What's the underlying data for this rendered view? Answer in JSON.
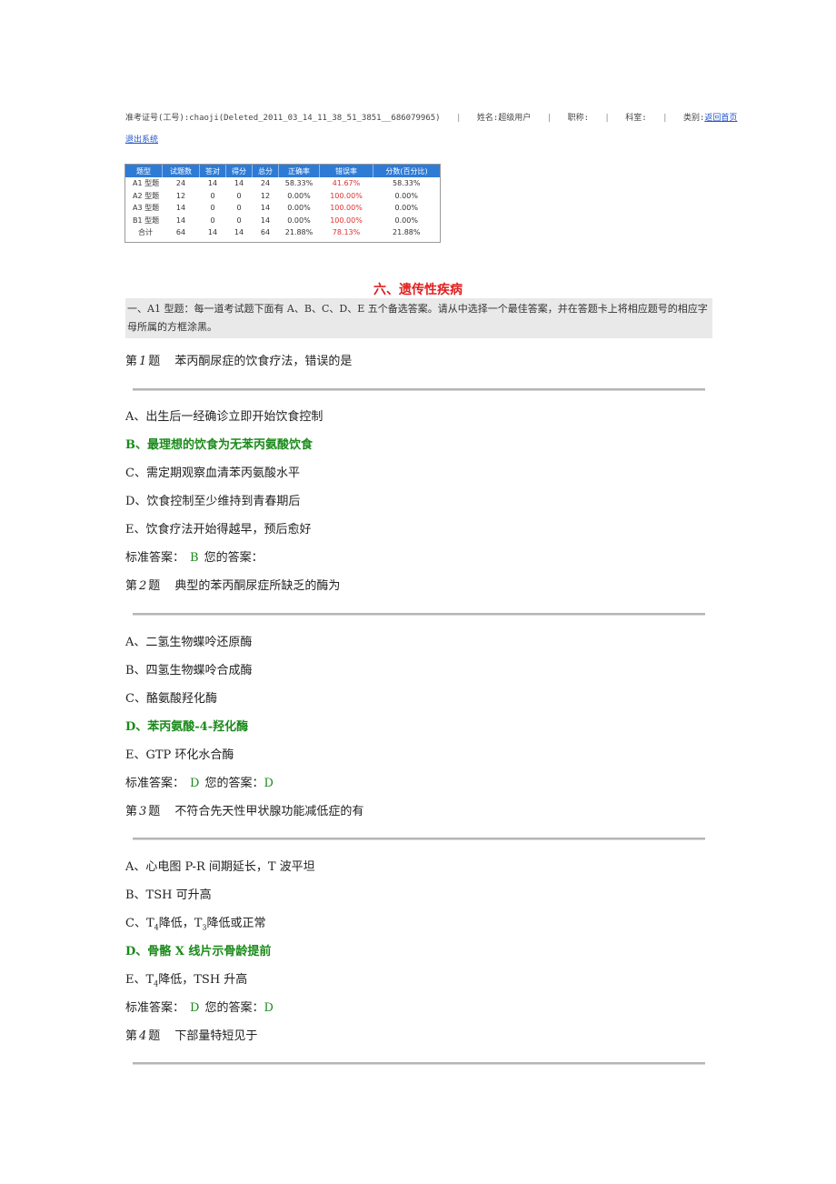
{
  "header": {
    "exam_id": "准考证号(工号):chaoji(Deleted_2011_03_14_11_38_51_3851__686079965)",
    "name": "姓名:超级用户",
    "title": "职称:",
    "dept": "科室:",
    "category": "类别:",
    "home_link": "返回首页",
    "logout_link": "退出系统"
  },
  "score_table": {
    "headers": [
      "题型",
      "试题数",
      "答对",
      "得分",
      "总分",
      "正确率",
      "错误率",
      "分数(百分比)"
    ],
    "rows": [
      [
        "A1 型题",
        "24",
        "14",
        "14",
        "24",
        "58.33%",
        "41.67%",
        "58.33%"
      ],
      [
        "A2 型题",
        "12",
        "0",
        "0",
        "12",
        "0.00%",
        "100.00%",
        "0.00%"
      ],
      [
        "A3 型题",
        "14",
        "0",
        "0",
        "14",
        "0.00%",
        "100.00%",
        "0.00%"
      ],
      [
        "B1 型题",
        "14",
        "0",
        "0",
        "14",
        "0.00%",
        "100.00%",
        "0.00%"
      ],
      [
        "合计",
        "64",
        "14",
        "14",
        "64",
        "21.88%",
        "78.13%",
        "21.88%"
      ]
    ]
  },
  "section": {
    "title": "六、遗传性疾病",
    "instruction": "一、A1 型题：每一道考试题下面有 A、B、C、D、E 五个备选答案。请从中选择一个最佳答案，并在答题卡上将相应题号的相应字母所属的方框涂黑。"
  },
  "labels": {
    "q_prefix": "第",
    "q_suffix": "题",
    "std_answer": "标准答案：",
    "your_answer": "您的答案："
  },
  "questions": [
    {
      "num": "1",
      "text": "苯丙酮尿症的饮食疗法，错误的是",
      "options": [
        "A、出生后一经确诊立即开始饮食控制",
        "B、最理想的饮食为无苯丙氨酸饮食",
        "C、需定期观察血清苯丙氨酸水平",
        "D、饮食控制至少维持到青春期后",
        "E、饮食疗法开始得越早，预后愈好"
      ],
      "correct": "B",
      "user_answer": ""
    },
    {
      "num": "2",
      "text": "典型的苯丙酮尿症所缺乏的酶为",
      "options": [
        "A、二氢生物蝶呤还原酶",
        "B、四氢生物蝶呤合成酶",
        "C、酪氨酸羟化酶",
        "D、苯丙氨酸-4-羟化酶",
        "E、GTP 环化水合酶"
      ],
      "correct": "D",
      "user_answer": "D"
    },
    {
      "num": "3",
      "text": "不符合先天性甲状腺功能减低症的有",
      "options": [
        "A、心电图 P-R 间期延长，T 波平坦",
        "B、TSH 可升高",
        "C、T4降低，T3降低或正常",
        "D、骨骼 X 线片示骨龄提前",
        "E、T4降低，TSH 升高"
      ],
      "correct": "D",
      "user_answer": "D"
    },
    {
      "num": "4",
      "text": "下部量特短见于"
    }
  ]
}
